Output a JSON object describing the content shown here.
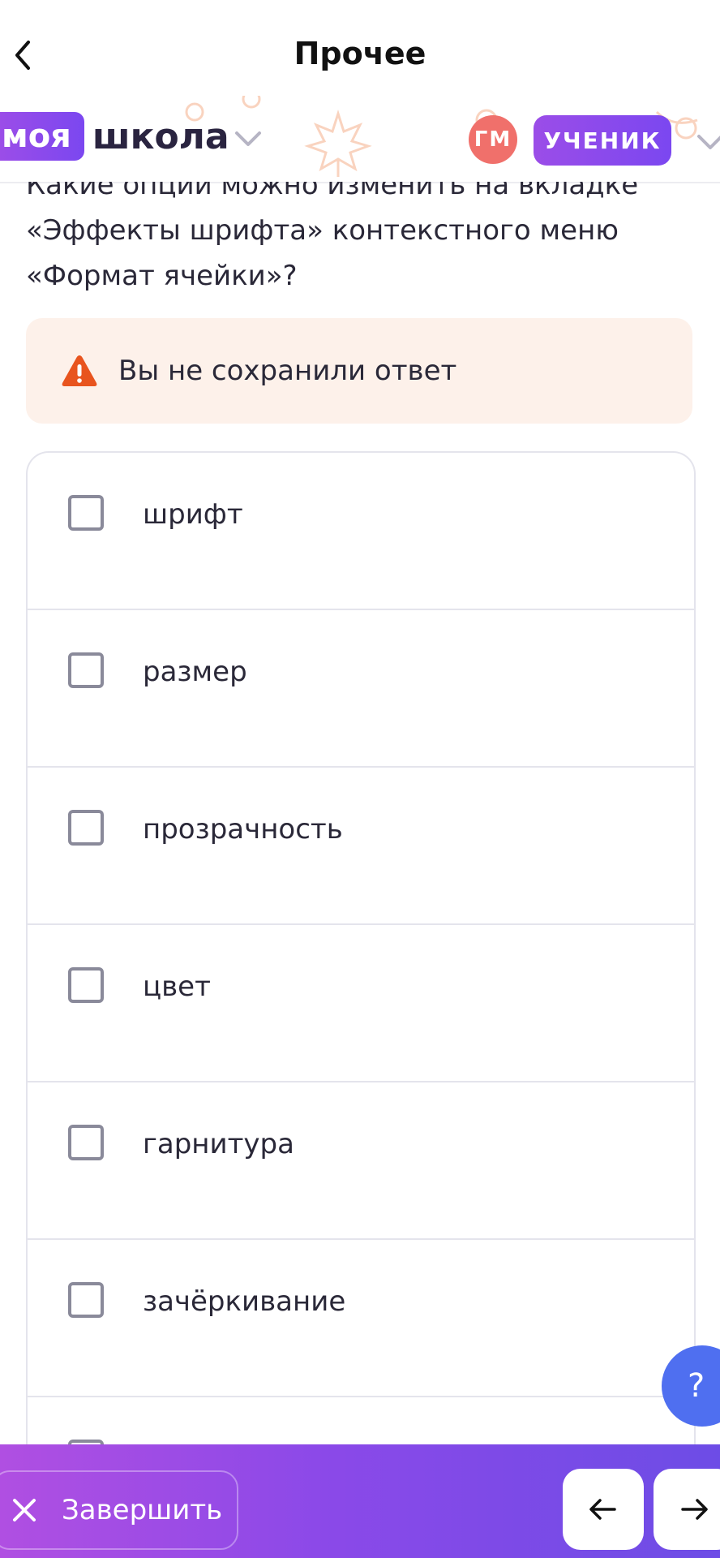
{
  "nav": {
    "title": "Прочее",
    "back_icon": "chevron-left-icon"
  },
  "school": {
    "logo_badge": "моя",
    "logo_word": "школа",
    "avatar_initials": "ГМ",
    "role": "УЧЕНИК"
  },
  "question": {
    "text": "Какие опции можно изменить на вкладке «Эффекты шрифта» контекстного меню «Формат ячейки»?"
  },
  "warning": {
    "text": "Вы не сохранили ответ",
    "icon": "warning-triangle-icon"
  },
  "options": [
    {
      "label": "шрифт",
      "checked": false
    },
    {
      "label": "размер",
      "checked": false
    },
    {
      "label": "прозрачность",
      "checked": false
    },
    {
      "label": "цвет",
      "checked": false
    },
    {
      "label": "гарнитура",
      "checked": false
    },
    {
      "label": "зачёркивание",
      "checked": false
    },
    {
      "label": "",
      "checked": false
    }
  ],
  "help": {
    "label": "?"
  },
  "footer": {
    "finish_label": "Завершить",
    "prev_icon": "arrow-left-icon",
    "next_icon": "arrow-right-icon"
  },
  "colors": {
    "accent": "#7b47f0",
    "avatar": "#f0706b",
    "warning_bg": "#fdf1ea",
    "warning_icon": "#e8541e",
    "help": "#4f6ff0"
  }
}
